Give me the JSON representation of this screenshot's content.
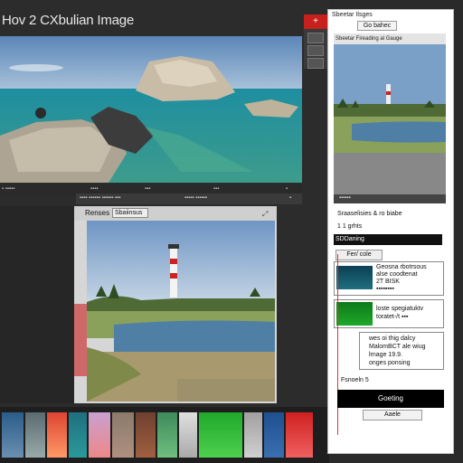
{
  "app": {
    "title": "Hov 2 CXbulian Image"
  },
  "toolbar": {
    "red_badge": "+"
  },
  "status_strip": {
    "items": [
      "▪ ▪▪▪▪▪",
      "▪▪▪▪",
      "▪▪▪",
      "▪▪▪",
      "▪"
    ],
    "mid_items": [
      "▪▪▪▪ ▪▪▪▪▪▪ ▪▪▪▪▪▪ ▪▪▪",
      "▪▪▪▪▪ ▪▪▪▪▪▪",
      "▪"
    ]
  },
  "preview": {
    "label": "Renses",
    "field": "Sbaiinsus"
  },
  "right_panel": {
    "title": "Sbeetar Ilsges",
    "tab": "Go bahec",
    "sub": "Sbeetar Fireading al Gauge",
    "dark_bar": "▪▪▪▪▪▪",
    "line1": "Sraaselisies & ro biabe",
    "line2": "1 1 grhts",
    "input_value": "SDDaning",
    "small_button": "Fer/ cole",
    "block1": [
      "Geosna rbotrsous",
      "alse coodtenat",
      "2T BISK",
      "▪▪▪▪▪▪▪▪"
    ],
    "block2": [
      "loste spegiatuktv",
      "toratet-/t ▪▪▪"
    ],
    "block3": [
      "wes oi thig dalcy",
      "MalomBCT ale wiug",
      "lrnage 19.9.",
      "onges ponsing"
    ],
    "footer_label": "Fsnoeln 5",
    "primary_button": "Goeting",
    "secondary_button": "Aaele"
  },
  "colors": {
    "accent_red": "#c8201c",
    "panel_bg": "#2c2c2c",
    "swatch_teal": "#1f6f7f",
    "swatch_green": "#1fa82a"
  }
}
